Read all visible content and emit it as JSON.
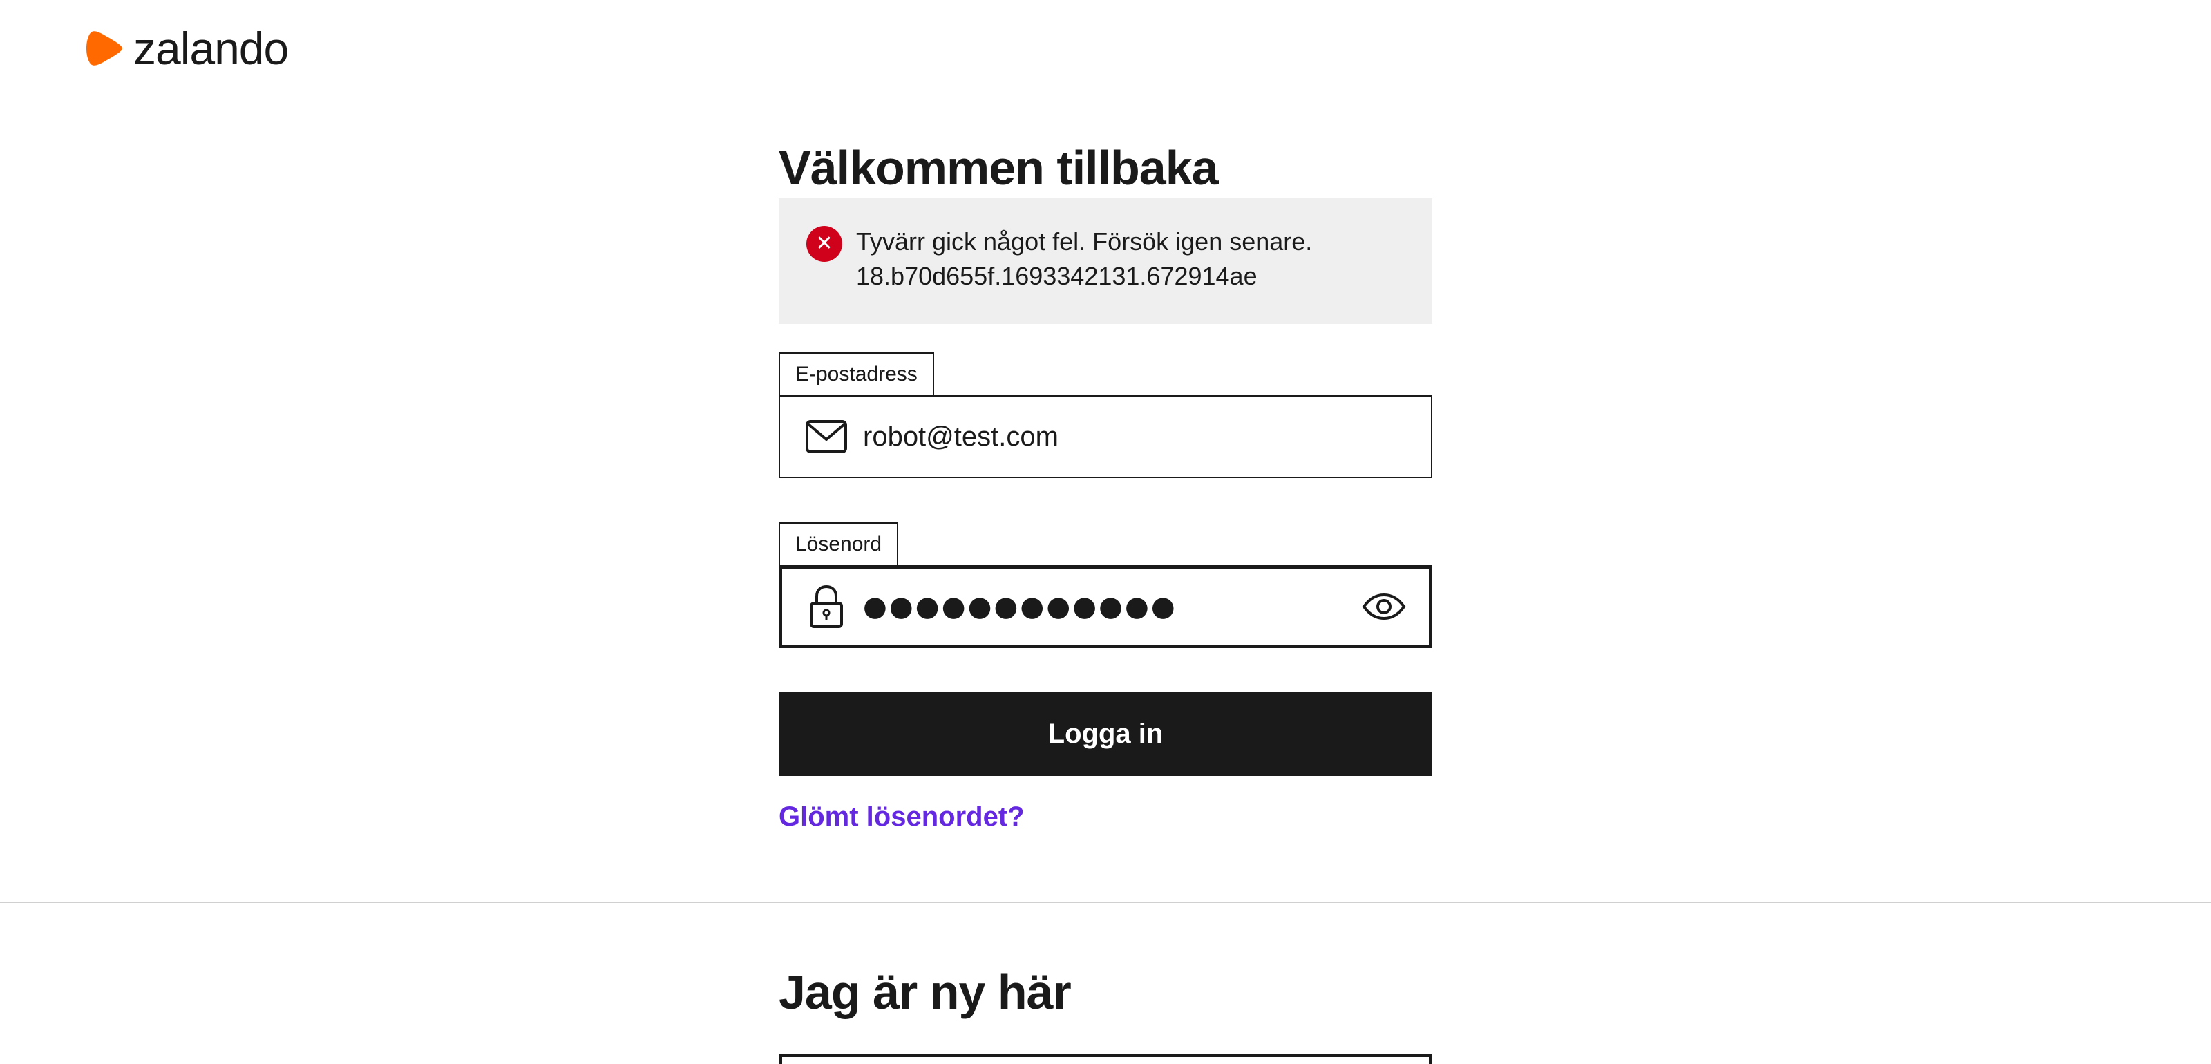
{
  "brand": {
    "name": "zalando",
    "accent_color": "#ff6900"
  },
  "login": {
    "title": "Välkommen tillbaka",
    "error": {
      "line1": "Tyvärr gick något fel. Försök igen senare.",
      "line2": "18.b70d655f.1693342131.672914ae",
      "icon": "error-x-icon",
      "color": "#d0021b"
    },
    "email": {
      "label": "E-postadress",
      "value": "robot@test.com",
      "icon": "envelope-icon"
    },
    "password": {
      "label": "Lösenord",
      "masked_value": "●●●●●●●●●●●●",
      "icon": "lock-icon",
      "toggle_icon": "eye-icon"
    },
    "submit_label": "Logga in",
    "forgot_label": "Glömt lösenordet?",
    "link_color": "#6328e0"
  },
  "register": {
    "title": "Jag är ny här"
  }
}
